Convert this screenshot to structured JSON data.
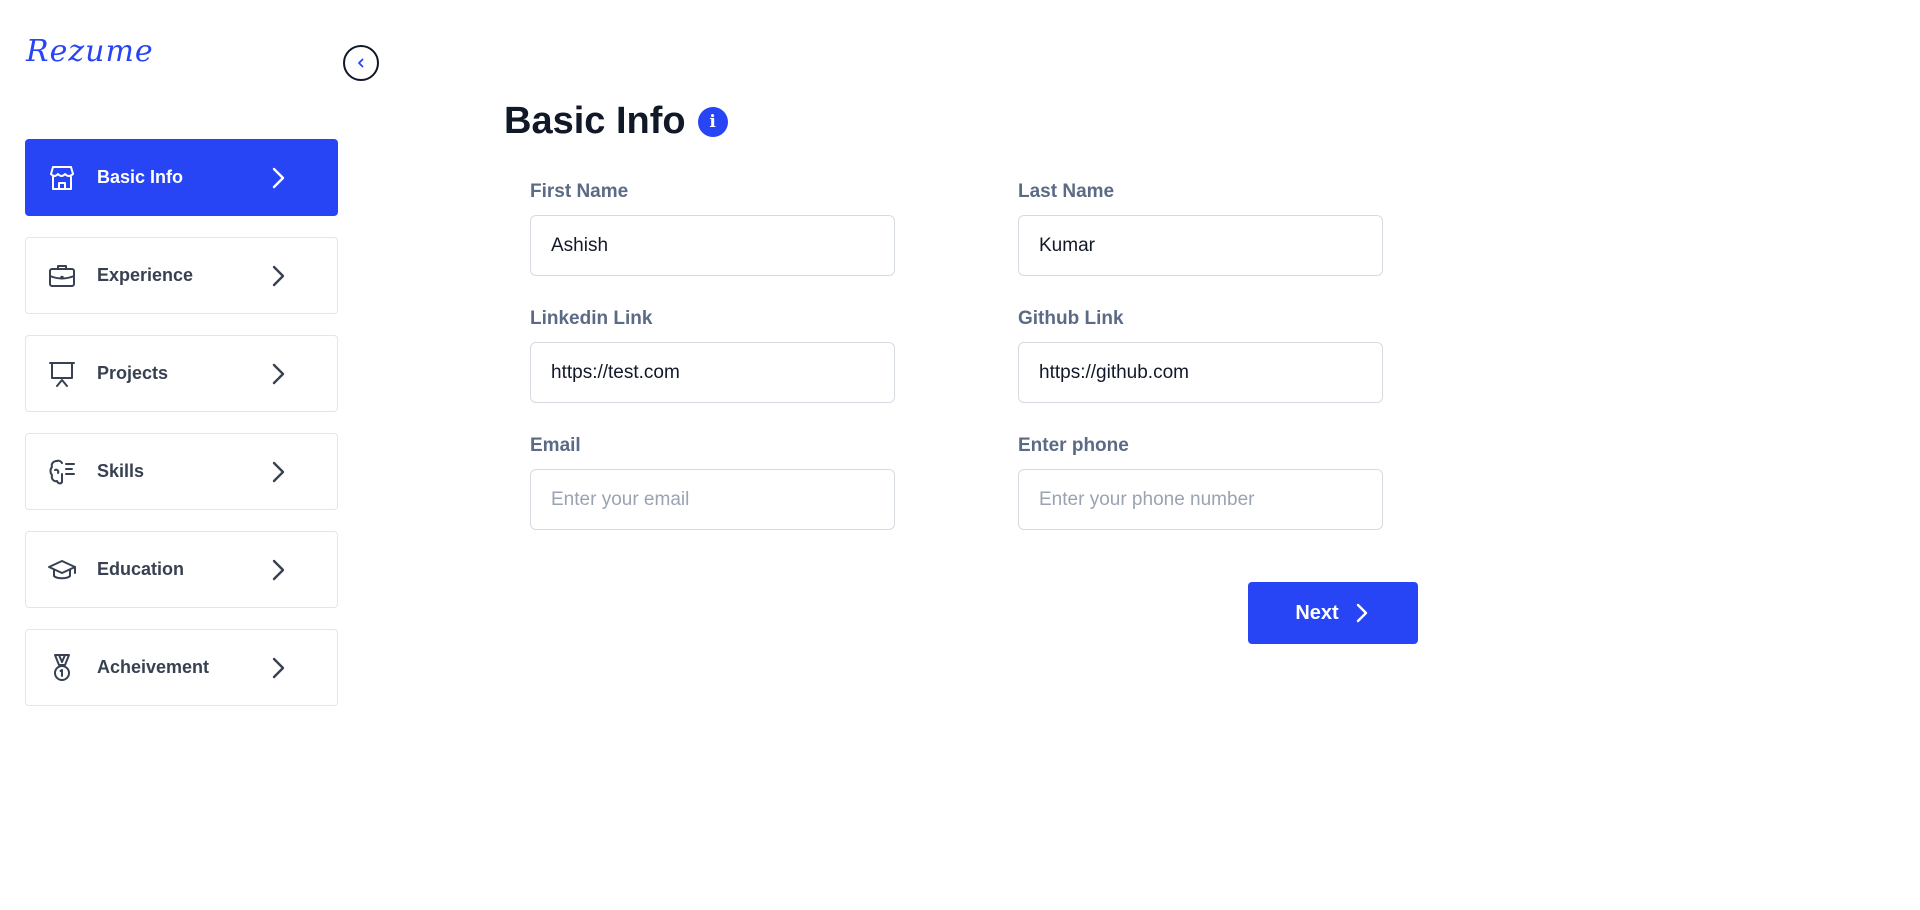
{
  "app": {
    "logo": "Rezume"
  },
  "sidebar": {
    "items": [
      {
        "label": "Basic Info",
        "icon": "store-icon",
        "active": true
      },
      {
        "label": "Experience",
        "icon": "briefcase-icon",
        "active": false
      },
      {
        "label": "Projects",
        "icon": "presentation-icon",
        "active": false
      },
      {
        "label": "Skills",
        "icon": "brain-icon",
        "active": false
      },
      {
        "label": "Education",
        "icon": "graduation-cap-icon",
        "active": false
      },
      {
        "label": "Acheivement",
        "icon": "medal-icon",
        "active": false
      }
    ]
  },
  "main": {
    "title": "Basic Info",
    "fields": {
      "first_name": {
        "label": "First Name",
        "value": "Ashish",
        "placeholder": ""
      },
      "last_name": {
        "label": "Last Name",
        "value": "Kumar",
        "placeholder": ""
      },
      "linkedin": {
        "label": "Linkedin Link",
        "value": "https://test.com",
        "placeholder": ""
      },
      "github": {
        "label": "Github Link",
        "value": "https://github.com",
        "placeholder": ""
      },
      "email": {
        "label": "Email",
        "value": "",
        "placeholder": "Enter your email"
      },
      "phone": {
        "label": "Enter phone",
        "value": "",
        "placeholder": "Enter your phone number"
      }
    },
    "next_label": "Next"
  },
  "colors": {
    "accent": "#2744f5",
    "label": "#5b6a85",
    "border": "#e2e6ec"
  }
}
